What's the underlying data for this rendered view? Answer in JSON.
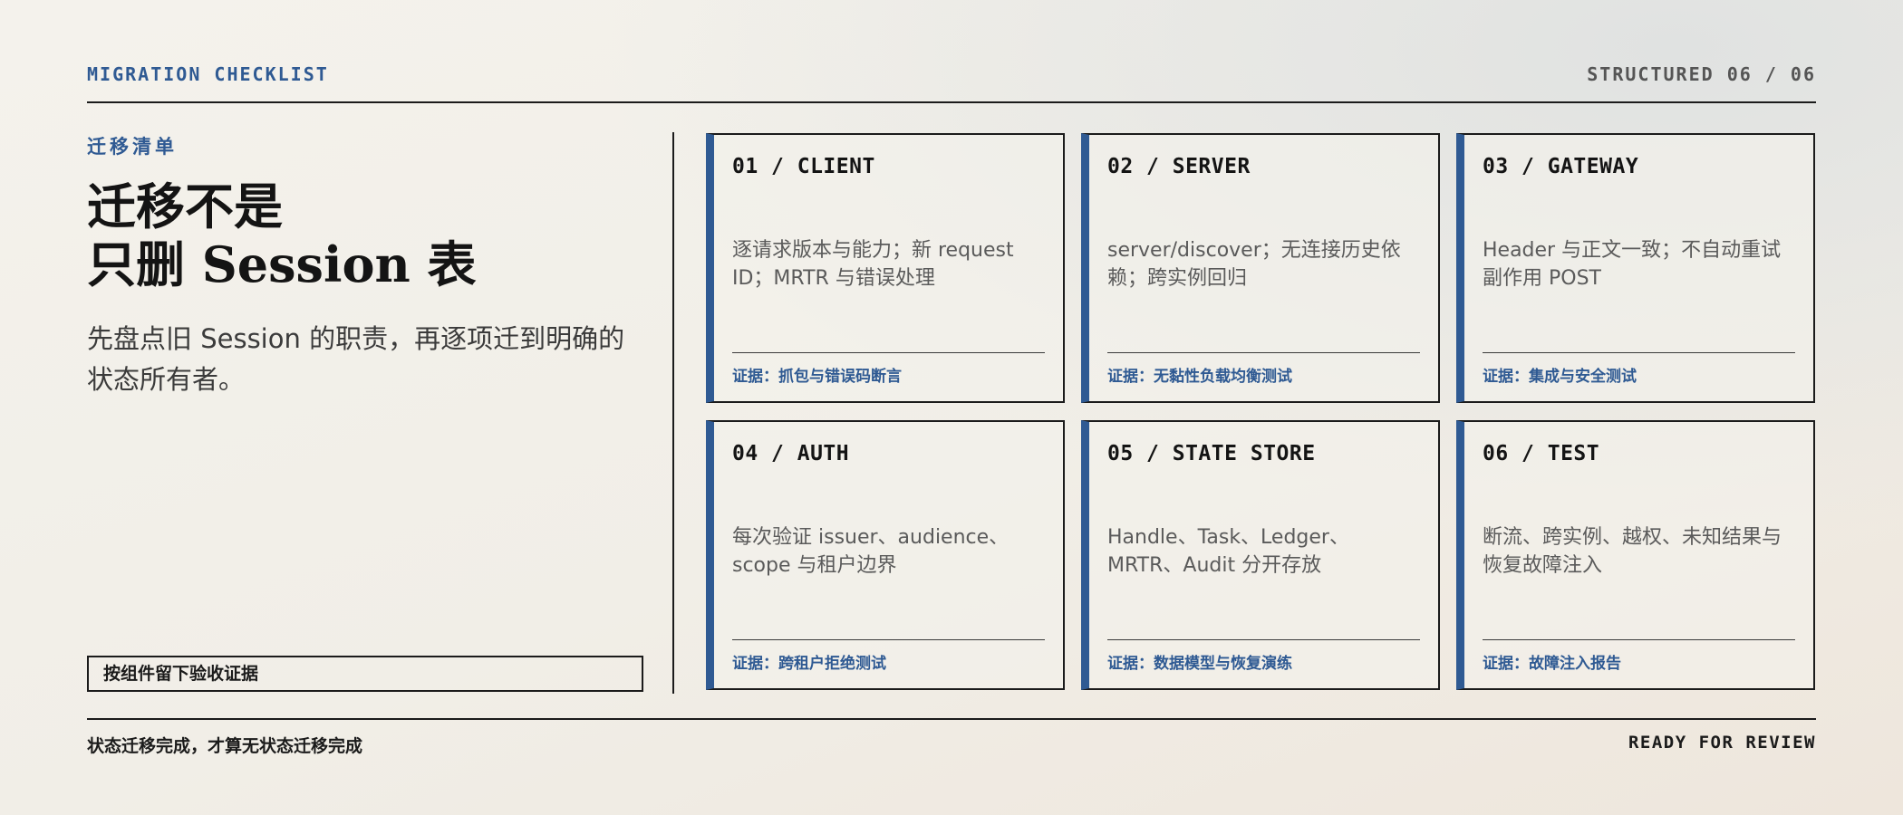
{
  "header": {
    "eyebrow": "MIGRATION CHECKLIST",
    "pager": "STRUCTURED 06 / 06"
  },
  "intro": {
    "kicker": "迁移清单",
    "title_line1": "迁移不是",
    "title_line2": "只删 Session 表",
    "lead": "先盘点旧 Session 的职责，再逐项迁到明确的状态所有者。",
    "tag": "按组件留下验收证据"
  },
  "cards": [
    {
      "title": "01 / CLIENT",
      "body": "逐请求版本与能力；新 request ID；MRTR 与错误处理",
      "evidence": "证据：抓包与错误码断言"
    },
    {
      "title": "02 / SERVER",
      "body": "server/discover；无连接历史依赖；跨实例回归",
      "evidence": "证据：无黏性负载均衡测试"
    },
    {
      "title": "03 / GATEWAY",
      "body": "Header 与正文一致；不自动重试副作用 POST",
      "evidence": "证据：集成与安全测试"
    },
    {
      "title": "04 / AUTH",
      "body": "每次验证 issuer、audience、scope 与租户边界",
      "evidence": "证据：跨租户拒绝测试"
    },
    {
      "title": "05 / STATE STORE",
      "body": "Handle、Task、Ledger、MRTR、Audit 分开存放",
      "evidence": "证据：数据模型与恢复演练"
    },
    {
      "title": "06 / TEST",
      "body": "断流、跨实例、越权、未知结果与恢复故障注入",
      "evidence": "证据：故障注入报告"
    }
  ],
  "footer": {
    "left": "状态迁移完成，才算无状态迁移完成",
    "right": "READY FOR REVIEW"
  },
  "colors": {
    "accent": "#2f5a93",
    "ink": "#1b1b1b",
    "paper": "#f3f1eb"
  }
}
